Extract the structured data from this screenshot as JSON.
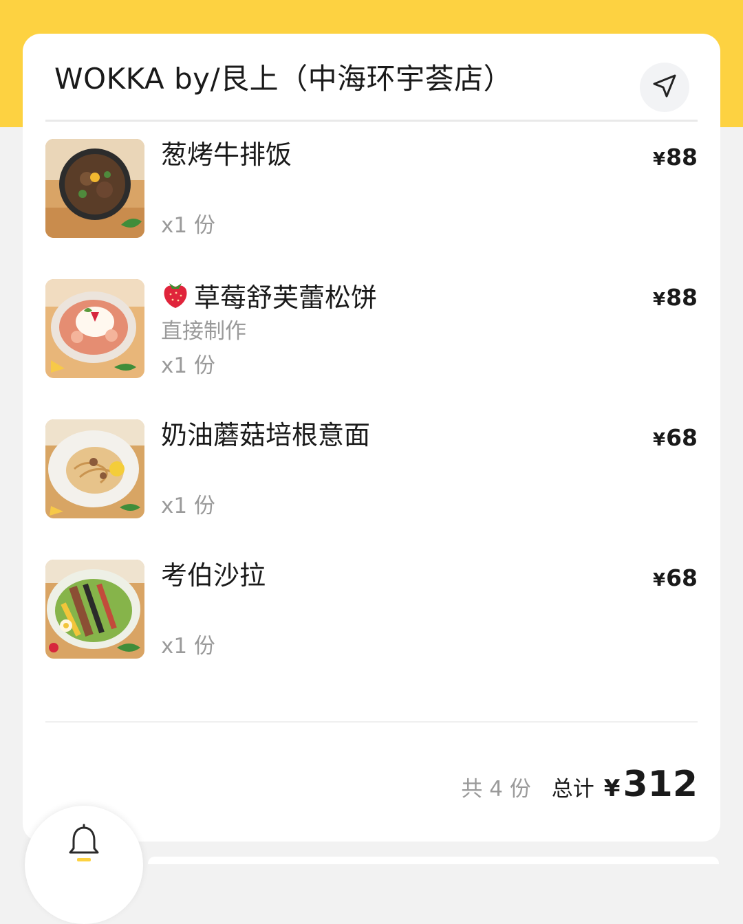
{
  "header": {
    "shop_name": "WOKKA by/艮上（中海环宇荟店）",
    "nav_icon": "navigation-arrow-icon"
  },
  "colors": {
    "accent": "#fdd241",
    "background": "#f2f2f2",
    "card": "#ffffff",
    "muted_text": "#9a9a9a"
  },
  "items": [
    {
      "name": "葱烤牛排饭",
      "note": "",
      "qty": "x1 份",
      "currency": "¥",
      "price": "88",
      "image": "beef-rice-bowl-photo"
    },
    {
      "name": "草莓舒芙蕾松饼",
      "note": "直接制作",
      "qty": "x1 份",
      "currency": "¥",
      "price": "88",
      "image": "strawberry-souffle-pancake-photo",
      "emoji": "strawberry-emoji"
    },
    {
      "name": "奶油蘑菇培根意面",
      "note": "",
      "qty": "x1 份",
      "currency": "¥",
      "price": "68",
      "image": "cream-mushroom-bacon-pasta-photo"
    },
    {
      "name": "考伯沙拉",
      "note": "",
      "qty": "x1 份",
      "currency": "¥",
      "price": "68",
      "image": "cobb-salad-photo"
    }
  ],
  "summary": {
    "count_text": "共 4 份",
    "total_label": "总计",
    "currency": "¥",
    "total_value": "312"
  },
  "fab": {
    "icon": "bell-icon"
  }
}
